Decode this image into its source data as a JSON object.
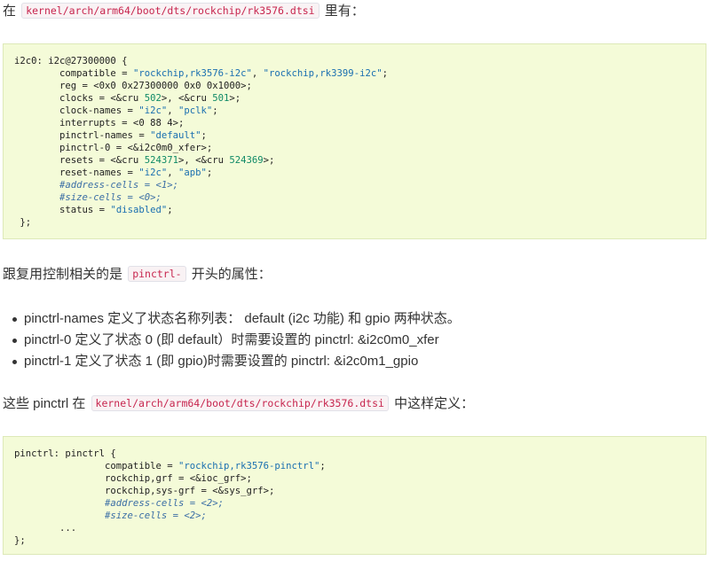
{
  "intro": {
    "before": "在",
    "path": "kernel/arch/arm64/boot/dts/rockchip/rk3576.dtsi",
    "after": "里有："
  },
  "code1": {
    "lines": [
      [
        {
          "t": "i2c0: i2c@27300000 {"
        }
      ],
      [
        {
          "t": "        compatible = "
        },
        {
          "t": "\"rockchip,rk3576-i2c\"",
          "c": "str"
        },
        {
          "t": ", "
        },
        {
          "t": "\"rockchip,rk3399-i2c\"",
          "c": "str"
        },
        {
          "t": ";"
        }
      ],
      [
        {
          "t": "        reg = <0x0 0x27300000 0x0 0x1000>;"
        }
      ],
      [
        {
          "t": "        clocks = <&cru "
        },
        {
          "t": "502",
          "c": "num"
        },
        {
          "t": ">, <&cru "
        },
        {
          "t": "501",
          "c": "num"
        },
        {
          "t": ">;"
        }
      ],
      [
        {
          "t": "        clock-names = "
        },
        {
          "t": "\"i2c\"",
          "c": "str"
        },
        {
          "t": ", "
        },
        {
          "t": "\"pclk\"",
          "c": "str"
        },
        {
          "t": ";"
        }
      ],
      [
        {
          "t": "        interrupts = <0 88 4>;"
        }
      ],
      [
        {
          "t": "        pinctrl-names = "
        },
        {
          "t": "\"default\"",
          "c": "str"
        },
        {
          "t": ";"
        }
      ],
      [
        {
          "t": "        pinctrl-0 = <&i2c0m0_xfer>;"
        }
      ],
      [
        {
          "t": "        resets = <&cru "
        },
        {
          "t": "524371",
          "c": "num"
        },
        {
          "t": ">, <&cru "
        },
        {
          "t": "524369",
          "c": "num"
        },
        {
          "t": ">;"
        }
      ],
      [
        {
          "t": "        reset-names = "
        },
        {
          "t": "\"i2c\"",
          "c": "str"
        },
        {
          "t": ", "
        },
        {
          "t": "\"apb\"",
          "c": "str"
        },
        {
          "t": ";"
        }
      ],
      [
        {
          "t": "        #address-cells = <1>;",
          "c": "cmt"
        }
      ],
      [
        {
          "t": "        #size-cells = <0>;",
          "c": "cmt"
        }
      ],
      [
        {
          "t": "        status = "
        },
        {
          "t": "\"disabled\"",
          "c": "str"
        },
        {
          "t": ";"
        }
      ],
      [
        {
          "t": " };"
        }
      ]
    ]
  },
  "sentence2": {
    "before": "跟复用控制相关的是",
    "code": "pinctrl-",
    "after": "开头的属性："
  },
  "bullets": [
    "pinctrl-names 定义了状态名称列表： default (i2c 功能) 和 gpio 两种状态。",
    "pinctrl-0 定义了状态 0 (即 default）时需要设置的 pinctrl: &i2c0m0_xfer",
    "pinctrl-1 定义了状态 1 (即 gpio)时需要设置的 pinctrl: &i2c0m1_gpio"
  ],
  "sentence3": {
    "before": "这些 pinctrl 在",
    "path": "kernel/arch/arm64/boot/dts/rockchip/rk3576.dtsi",
    "after": "中这样定义："
  },
  "code2": {
    "lines": [
      [
        {
          "t": "pinctrl: pinctrl {"
        }
      ],
      [
        {
          "t": "                compatible = "
        },
        {
          "t": "\"rockchip,rk3576-pinctrl\"",
          "c": "str"
        },
        {
          "t": ";"
        }
      ],
      [
        {
          "t": "                rockchip,grf = <&ioc_grf>;"
        }
      ],
      [
        {
          "t": "                rockchip,sys-grf = <&sys_grf>;"
        }
      ],
      [
        {
          "t": "                #address-cells = <2>;",
          "c": "cmt"
        }
      ],
      [
        {
          "t": "                #size-cells = <2>;",
          "c": "cmt"
        }
      ],
      [
        {
          "t": "        ..."
        }
      ],
      [
        {
          "t": "};"
        }
      ]
    ]
  }
}
